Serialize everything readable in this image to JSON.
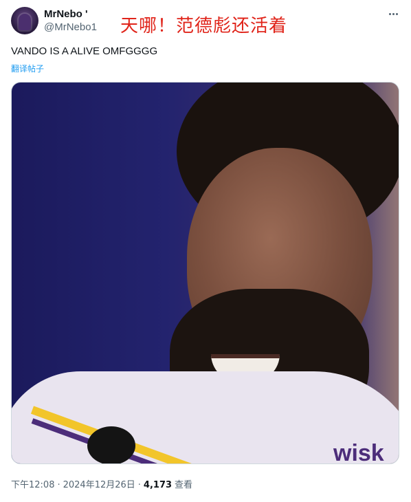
{
  "author": {
    "name": "MrNebo '",
    "handle": "@MrNebo1",
    "avatar_icon": "avatar-image"
  },
  "overlay_caption": "天哪！范德彪还活着",
  "tweet": {
    "text": "VANDO IS A ALIVE OMFGGGG",
    "translate_label": "翻译帖子",
    "media_text": "wisk"
  },
  "meta": {
    "time": "下午12:08",
    "separator": "·",
    "date": "2024年12月26日",
    "views_count": "4,173",
    "views_label": "查看"
  },
  "icons": {
    "more": "more-horizontal-icon"
  },
  "colors": {
    "link": "#1d9bf0",
    "caption": "#e0241a",
    "secondary_text": "#536471"
  }
}
